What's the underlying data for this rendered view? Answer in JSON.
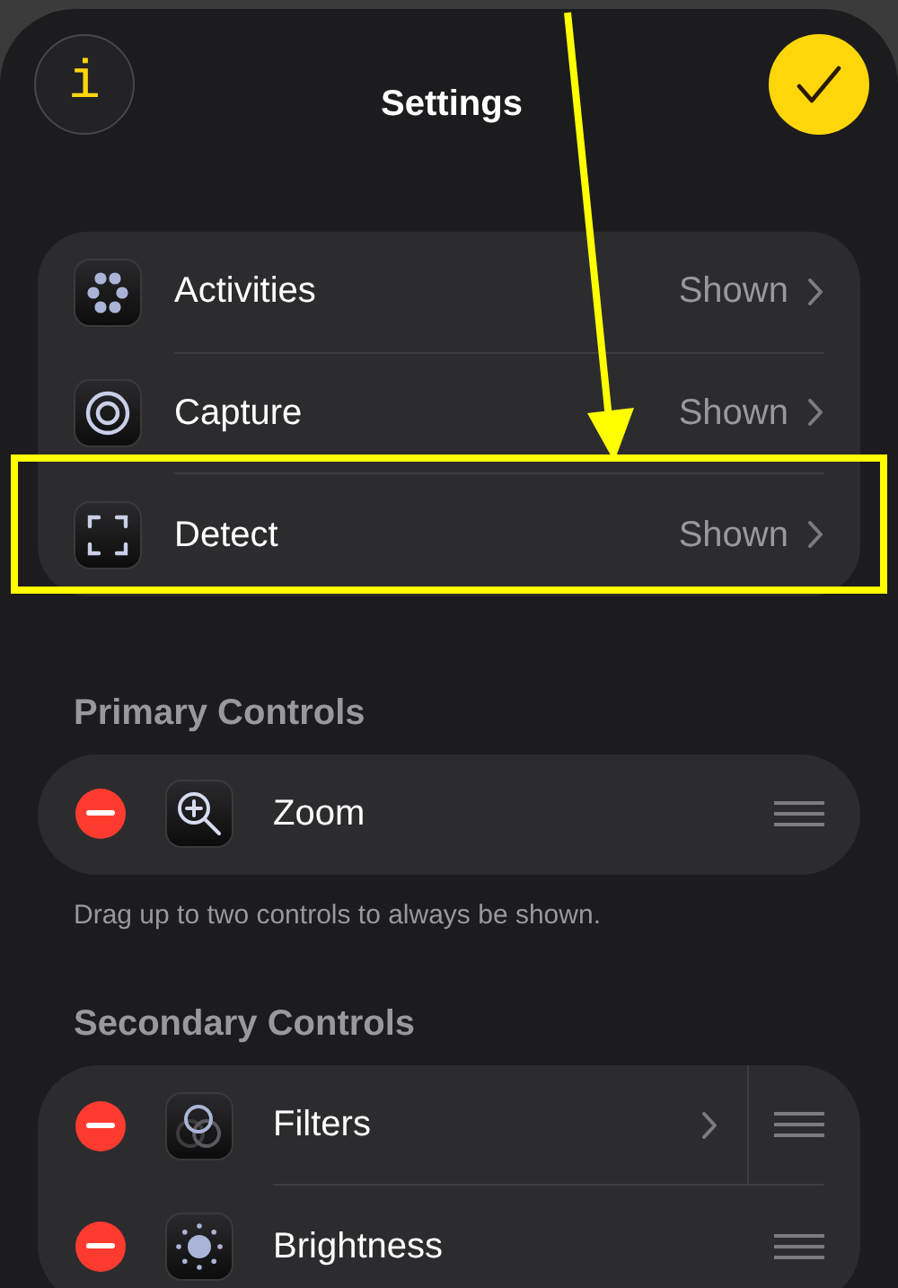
{
  "header": {
    "title": "Settings",
    "info_label": "i"
  },
  "visibility": [
    {
      "label": "Activities",
      "value": "Shown",
      "kind": "dots",
      "highlighted": false
    },
    {
      "label": "Capture",
      "value": "Shown",
      "kind": "target",
      "highlighted": false
    },
    {
      "label": "Detect",
      "value": "Shown",
      "kind": "frame",
      "highlighted": true
    }
  ],
  "callout_arrow": true,
  "primary": {
    "title": "Primary Controls",
    "controls": [
      {
        "label": "Zoom",
        "kind": "zoom",
        "chevron": false
      }
    ],
    "footer": "Drag up to two controls to always be shown."
  },
  "secondary": {
    "title": "Secondary Controls",
    "controls": [
      {
        "label": "Filters",
        "kind": "filters",
        "chevron": true
      },
      {
        "label": "Brightness",
        "kind": "sun",
        "chevron": false
      }
    ]
  }
}
